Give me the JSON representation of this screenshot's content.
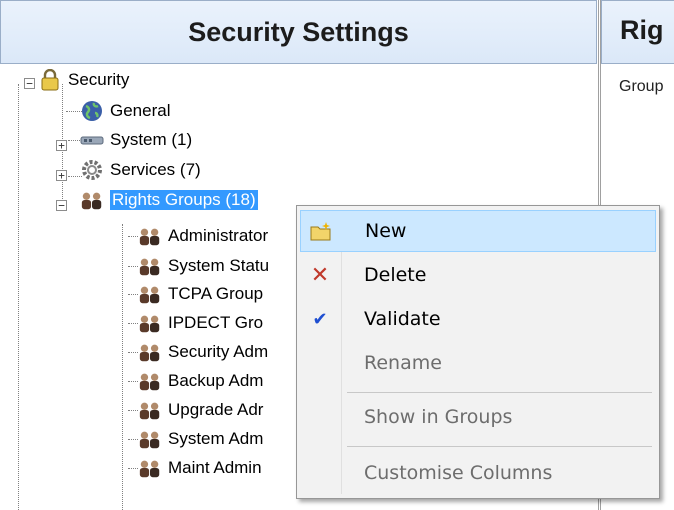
{
  "left_panel": {
    "title": "Security Settings"
  },
  "right_panel": {
    "title": "Rig",
    "column_header": "Group"
  },
  "tree": {
    "root": {
      "label": "Security",
      "icon": "padlock-icon",
      "expander": "−"
    },
    "children": [
      {
        "label": "General",
        "icon": "globe-icon",
        "expander": ""
      },
      {
        "label": "System (1)",
        "icon": "network-icon",
        "expander": "+"
      },
      {
        "label": "Services (7)",
        "icon": "gear-icon",
        "expander": "+"
      },
      {
        "label": "Rights Groups (18)",
        "icon": "users-group-icon",
        "expander": "−",
        "selected": true
      }
    ],
    "groups": [
      "Administrator",
      "System Statu",
      "TCPA Group",
      "IPDECT Gro",
      "Security Adm",
      "Backup Adm",
      "Upgrade Adr",
      "System Adm",
      "Maint Admin"
    ]
  },
  "context_menu": {
    "items": [
      {
        "label": "New",
        "icon": "new-folder-icon",
        "enabled": true,
        "hover": true
      },
      {
        "label": "Delete",
        "icon": "delete-x-icon",
        "enabled": true,
        "color": "#c0392b"
      },
      {
        "label": "Validate",
        "icon": "checkmark-icon",
        "enabled": true,
        "color": "#1f4fd1"
      },
      {
        "label": "Rename",
        "icon": "",
        "enabled": false
      },
      {
        "label": "Show in Groups",
        "icon": "",
        "enabled": false
      },
      {
        "label": "Customise Columns",
        "icon": "",
        "enabled": false
      }
    ]
  }
}
